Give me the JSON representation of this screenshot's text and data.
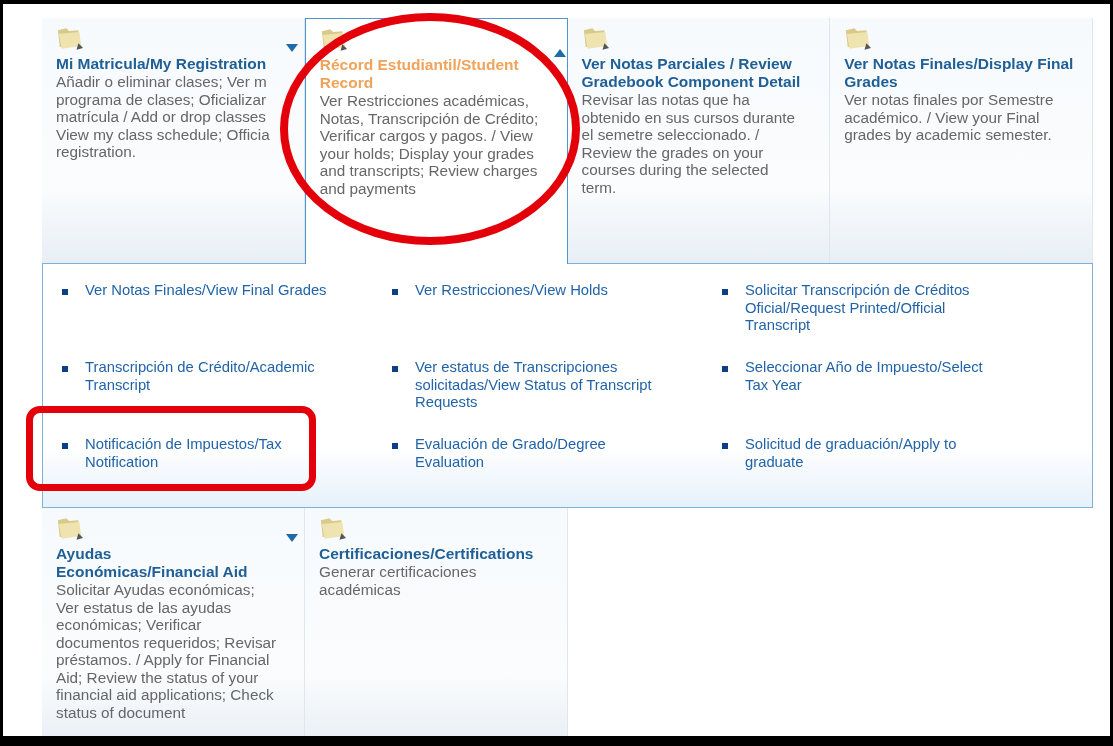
{
  "top_cards": [
    {
      "title": "Mi Matricula/My Registration",
      "description_lines": [
        "Añadir o eliminar clases; Ver m",
        "programa de clases; Oficializar",
        "matrícula / Add or drop classes",
        "View my class schedule; Officia",
        "registration."
      ],
      "selected": false,
      "has_submenu": true,
      "expanded": false,
      "circled": false
    },
    {
      "title": "Récord Estudiantil/Student Record",
      "description_lines": [
        "Ver Restricciones académicas,",
        "Notas, Transcripción de Crédito;",
        "Verificar cargos y pagos. / View",
        "your holds; Display your grades",
        "and transcripts; Review charges",
        "and payments"
      ],
      "selected": true,
      "has_submenu": true,
      "expanded": true,
      "circled": true
    },
    {
      "title": "Ver Notas Parciales / Review Gradebook Component Detail",
      "description_lines": [
        "Revisar las notas que ha",
        "obtenido en sus cursos durante",
        "el semetre seleccionado. /",
        "Review the grades on your",
        "courses during the selected",
        "term."
      ],
      "selected": false,
      "has_submenu": false,
      "expanded": false,
      "circled": false
    },
    {
      "title": "Ver Notas Finales/Display Final Grades",
      "description_lines": [
        "Ver notas finales por Semestre",
        "académico. / View your Final",
        "grades by academic semester."
      ],
      "selected": false,
      "has_submenu": false,
      "expanded": false,
      "circled": false
    }
  ],
  "submenu_links": [
    {
      "label": "Ver Notas Finales/View Final Grades",
      "boxed": false
    },
    {
      "label": "Ver Restricciones/View Holds",
      "boxed": false
    },
    {
      "label": "Solicitar Transcripción de Créditos Oficial/Request Printed/Official Transcript",
      "boxed": false
    },
    {
      "label": "Transcripción de Crédito/Academic Transcript",
      "boxed": false
    },
    {
      "label": "Ver estatus de Transcripciones solicitadas/View Status of Transcript Requests",
      "boxed": false
    },
    {
      "label": "Seleccionar Año de Impuesto/Select Tax Year",
      "boxed": false
    },
    {
      "label": "Notificación de Impuestos/Tax Notification",
      "boxed": true
    },
    {
      "label": "Evaluación de Grado/Degree Evaluation",
      "boxed": false
    },
    {
      "label": "Solicitud de graduación/Apply to graduate",
      "boxed": false
    }
  ],
  "bottom_cards": [
    {
      "title": "Ayudas Económicas/Financial Aid",
      "description_lines": [
        "Solicitar Ayudas económicas;",
        "Ver estatus de las ayudas",
        "económicas; Verificar",
        "documentos requeridos; Revisar",
        "préstamos. / Apply for Financial",
        "Aid; Review the status of your",
        "financial aid applications; Check",
        "status of document"
      ],
      "selected": false,
      "has_submenu": true,
      "expanded": false,
      "circled": false
    },
    {
      "title": "Certificaciones/Certifications",
      "description_lines": [
        "Generar certificaciones",
        "académicas"
      ],
      "selected": false,
      "has_submenu": false,
      "expanded": false,
      "circled": false
    }
  ]
}
